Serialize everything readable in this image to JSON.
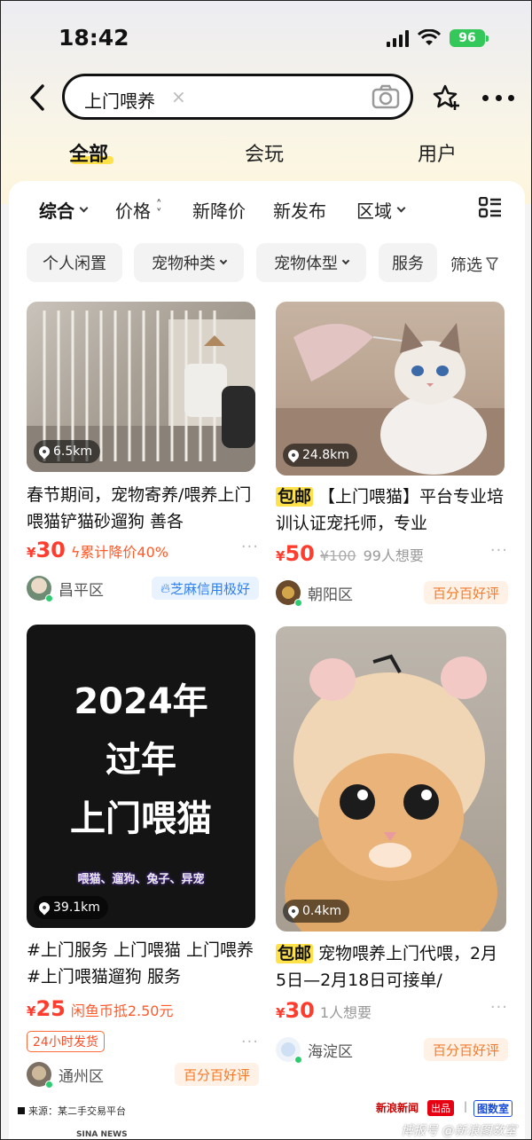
{
  "status": {
    "time": "18:42",
    "battery": "96"
  },
  "search": {
    "query": "上门喂养",
    "clear_icon": "×"
  },
  "tabs": [
    {
      "label": "全部",
      "active": true
    },
    {
      "label": "会玩",
      "active": false
    },
    {
      "label": "用户",
      "active": false
    }
  ],
  "sort": [
    {
      "label": "综合"
    },
    {
      "label": "价格"
    },
    {
      "label": "新降价"
    },
    {
      "label": "新发布"
    },
    {
      "label": "区域"
    }
  ],
  "chips": [
    {
      "label": "个人闲置"
    },
    {
      "label": "宠物种类"
    },
    {
      "label": "宠物体型"
    },
    {
      "label": "服务"
    }
  ],
  "filter_label": "筛选",
  "cards": [
    {
      "distance": "6.5km",
      "title": "春节期间，宠物寄养/喂养上门喂猫铲猫砂遛狗 善各",
      "currency": "¥",
      "price": "30",
      "drop": "累计降价40%",
      "more": "···",
      "district": "昌平区",
      "badge": "芝麻信用极好"
    },
    {
      "distance": "24.8km",
      "tag": "包邮",
      "title": "【上门喂猫】平台专业培训认证宠托师，专业",
      "currency": "¥",
      "price": "50",
      "orig_price": "¥100",
      "want": "99人想要",
      "more": "···",
      "district": "朝阳区",
      "badge": "百分百好评"
    },
    {
      "distance": "39.1km",
      "poster": {
        "line1": "2024年",
        "line2": "过年",
        "line3": "上门喂猫",
        "footer": "喂猫、遛狗、兔子、异宠"
      },
      "title": "#上门服务 上门喂猫 上门喂养 #上门喂猫遛狗 服务",
      "currency": "¥",
      "price": "25",
      "drop": "闲鱼币抵2.50元",
      "service_tag": "24小时发货",
      "more": "···",
      "district": "通州区",
      "badge": "百分百好评"
    },
    {
      "distance": "0.4km",
      "tag": "包邮",
      "title": "宠物喂养上门代喂，2月5日—2月18日可接单/",
      "currency": "¥",
      "price": "30",
      "want": "1人想要",
      "more": "···",
      "district": "海淀区",
      "badge": "百分百好评"
    }
  ],
  "footer": {
    "source": "来源：某二手交易平台",
    "sina_news": "SINA NEWS",
    "brand_sina": "新浪新闻",
    "brand_out": "出品",
    "brand_sep": "|",
    "brand_tsj": "图数室",
    "watermark": "博报号 @新浪图数室"
  },
  "colors": {
    "accent": "#ffe24a",
    "price": "#ff3d2e",
    "good_badge": "#f37a2a",
    "credit_badge": "#2f7ff0"
  }
}
